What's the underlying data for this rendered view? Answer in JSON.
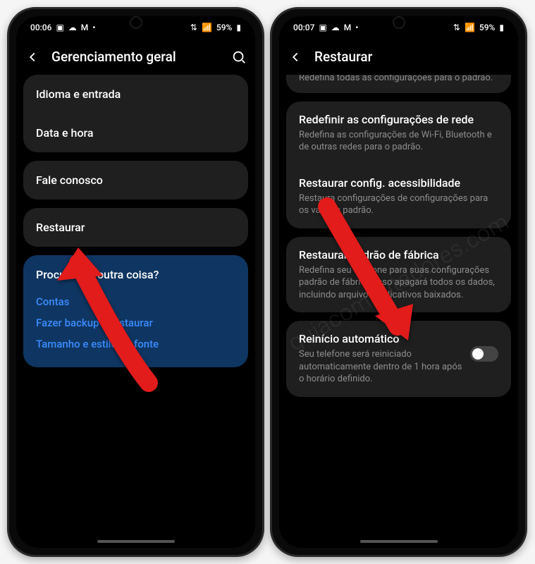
{
  "phone1": {
    "status": {
      "time": "00:06",
      "battery": "59%"
    },
    "header": {
      "title": "Gerenciamento geral"
    },
    "section1": {
      "item1": "Idioma e entrada",
      "item2": "Data e hora"
    },
    "section2": {
      "item1": "Fale conosco"
    },
    "section3": {
      "item1": "Restaurar"
    },
    "infobox": {
      "title": "Procurando outra coisa?",
      "link1": "Contas",
      "link2": "Fazer backup e restaurar",
      "link3": "Tamanho e estilo da fonte"
    }
  },
  "phone2": {
    "status": {
      "time": "00:07",
      "battery": "59%"
    },
    "header": {
      "title": "Restaurar"
    },
    "partial": "Redefina todas as configurações para o padrão.",
    "card1": {
      "title": "Redefinir as configurações de rede",
      "desc": "Redefina as configurações de Wi-Fi, Bluetooth e de outras redes para o padrão."
    },
    "card2": {
      "title": "Restaurar config. acessibilidade",
      "desc": "Restaura configurações de configurações para os valores padrão."
    },
    "card3": {
      "title": "Restaurar padrão de fábrica",
      "desc": "Redefina seu telefone para suas configurações padrão de fábrica. Isso apagará todos os dados, incluindo arquivo e aplicativos baixados."
    },
    "card4": {
      "title": "Reinício automático",
      "desc": "Seu telefone será reiniciado automaticamente dentro de 1 hora após o horário definido."
    }
  },
  "watermark": "guiacomputadores.com"
}
